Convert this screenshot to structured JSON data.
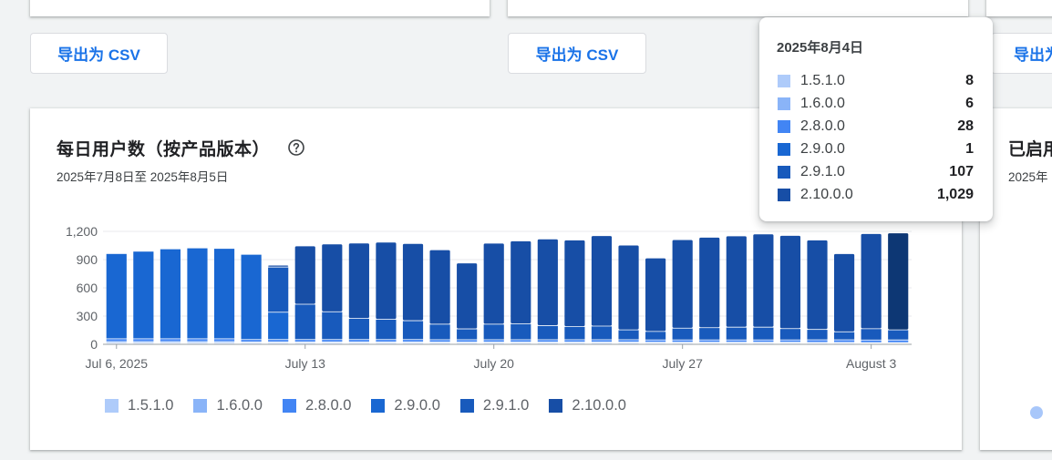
{
  "export": {
    "label": "导出为 CSV",
    "label_partial": "导出为"
  },
  "main_card": {
    "title": "每日用户数（按产品版本）",
    "subtitle": "2025年7月8日至 2025年8月5日"
  },
  "right_card": {
    "title": "已启用",
    "subtitle": "2025年"
  },
  "tooltip": {
    "date": "2025年8月4日",
    "rows": [
      {
        "label": "1.5.1.0",
        "value": "8",
        "color": "#aecbfa"
      },
      {
        "label": "1.6.0.0",
        "value": "6",
        "color": "#8ab4f8"
      },
      {
        "label": "2.8.0.0",
        "value": "28",
        "color": "#4285f4"
      },
      {
        "label": "2.9.0.0",
        "value": "1",
        "color": "#1967d2"
      },
      {
        "label": "2.9.1.0",
        "value": "107",
        "color": "#185abc"
      },
      {
        "label": "2.10.0.0",
        "value": "1,029",
        "color": "#174ea6"
      }
    ]
  },
  "colors": {
    "accent": "#1a73e8",
    "highlight_bar": "#0d3774",
    "grid": "#e8eaed",
    "axis": "#9aa0a6"
  },
  "chart_data": {
    "type": "bar",
    "stacked": true,
    "categories": [
      "2025-07-06",
      "2025-07-07",
      "2025-07-08",
      "2025-07-09",
      "2025-07-10",
      "2025-07-11",
      "2025-07-12",
      "2025-07-13",
      "2025-07-14",
      "2025-07-15",
      "2025-07-16",
      "2025-07-17",
      "2025-07-18",
      "2025-07-19",
      "2025-07-20",
      "2025-07-21",
      "2025-07-22",
      "2025-07-23",
      "2025-07-24",
      "2025-07-25",
      "2025-07-26",
      "2025-07-27",
      "2025-07-28",
      "2025-07-29",
      "2025-07-30",
      "2025-07-31",
      "2025-08-01",
      "2025-08-02",
      "2025-08-03",
      "2025-08-04"
    ],
    "x_tick_labels": [
      {
        "label": "Jul 6, 2025",
        "index": 0
      },
      {
        "label": "July 13",
        "index": 7
      },
      {
        "label": "July 20",
        "index": 14
      },
      {
        "label": "July 27",
        "index": 21
      },
      {
        "label": "August 3",
        "index": 28
      }
    ],
    "y_ticks": [
      "0",
      "300",
      "600",
      "900",
      "1,200"
    ],
    "ylim": [
      0,
      1200
    ],
    "grid": true,
    "legend_position": "bottom",
    "highlighted_index": 29,
    "series": [
      {
        "name": "1.5.1.0",
        "color": "#aecbfa",
        "values": [
          10,
          10,
          10,
          10,
          10,
          10,
          10,
          10,
          10,
          10,
          10,
          10,
          10,
          10,
          10,
          10,
          10,
          10,
          10,
          10,
          10,
          10,
          10,
          10,
          10,
          10,
          10,
          10,
          8,
          8
        ]
      },
      {
        "name": "1.6.0.0",
        "color": "#8ab4f8",
        "values": [
          15,
          15,
          15,
          15,
          15,
          12,
          12,
          12,
          12,
          12,
          12,
          12,
          10,
          10,
          10,
          10,
          10,
          10,
          10,
          10,
          8,
          8,
          8,
          8,
          8,
          8,
          6,
          6,
          6,
          6
        ]
      },
      {
        "name": "2.8.0.0",
        "color": "#4285f4",
        "values": [
          30,
          30,
          30,
          30,
          30,
          25,
          25,
          25,
          25,
          25,
          25,
          25,
          25,
          25,
          25,
          25,
          25,
          25,
          25,
          25,
          25,
          25,
          25,
          25,
          25,
          25,
          28,
          28,
          28,
          28
        ]
      },
      {
        "name": "2.9.0.0",
        "color": "#1967d2",
        "values": [
          905,
          930,
          955,
          965,
          960,
          905,
          290,
          0,
          0,
          0,
          0,
          0,
          0,
          0,
          0,
          0,
          0,
          0,
          0,
          0,
          0,
          0,
          0,
          0,
          0,
          0,
          0,
          0,
          0,
          1
        ]
      },
      {
        "name": "2.9.1.0",
        "color": "#185abc",
        "values": [
          0,
          0,
          0,
          0,
          0,
          0,
          480,
          375,
          295,
          225,
          215,
          200,
          165,
          115,
          165,
          170,
          150,
          140,
          145,
          105,
          90,
          125,
          130,
          135,
          135,
          120,
          110,
          85,
          120,
          107
        ]
      },
      {
        "name": "2.10.0.0",
        "color": "#174ea6",
        "values": [
          0,
          0,
          0,
          0,
          0,
          0,
          20,
          620,
          720,
          800,
          820,
          820,
          790,
          700,
          860,
          880,
          920,
          920,
          960,
          900,
          780,
          940,
          960,
          970,
          990,
          990,
          950,
          830,
          1010,
          1029
        ]
      }
    ]
  }
}
